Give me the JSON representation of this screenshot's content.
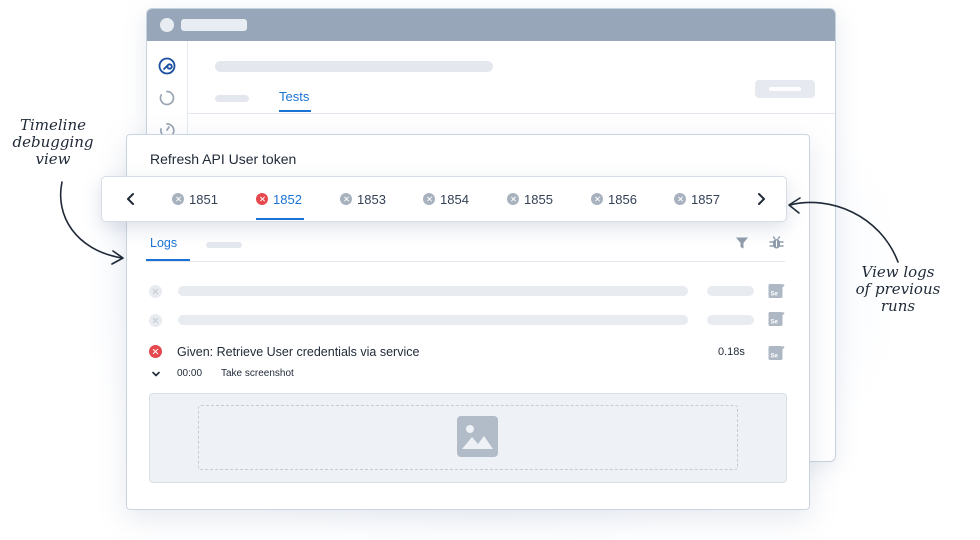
{
  "back_window": {
    "active_tab": "Tests"
  },
  "card": {
    "title": "Refresh API User token"
  },
  "runs": {
    "items": [
      {
        "id": "1851",
        "status": "cancelled"
      },
      {
        "id": "1852",
        "status": "failed",
        "active": true
      },
      {
        "id": "1853",
        "status": "cancelled"
      },
      {
        "id": "1854",
        "status": "cancelled"
      },
      {
        "id": "1855",
        "status": "cancelled"
      },
      {
        "id": "1856",
        "status": "cancelled"
      },
      {
        "id": "1857",
        "status": "cancelled"
      }
    ]
  },
  "logs": {
    "tab_label": "Logs",
    "step": {
      "text": "Given: Retrieve User credentials via service",
      "duration": "0.18s",
      "sub_time": "00:00",
      "sub_text": "Take screenshot"
    }
  },
  "annotations": {
    "left": "Timeline debugging view",
    "left_lines": [
      "Timeline",
      "debugging",
      "view"
    ],
    "right_lines": [
      "View logs",
      "of previous",
      "runs"
    ]
  },
  "colors": {
    "accent": "#1a73d4",
    "fail": "#e5484d",
    "neutral": "#a8b2bf"
  }
}
